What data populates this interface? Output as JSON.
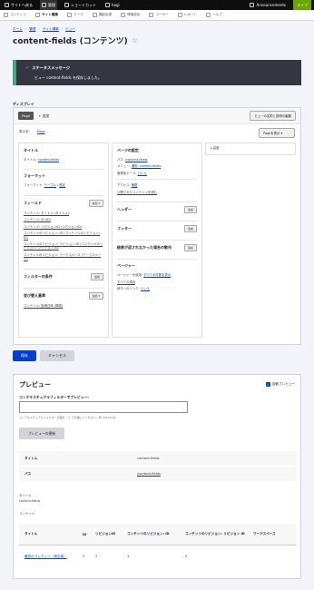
{
  "toolbar": {
    "back_label": "サイトへ戻る",
    "manage_label": "管理",
    "shortcuts_label": "ショートカット",
    "user_label": "hagi",
    "announcements_label": "Announcements",
    "live_label": "ライブ"
  },
  "tray": {
    "items": [
      "コンテンツ",
      "サイト構築",
      "テーマ",
      "機能拡張",
      "環境設定",
      "ユーザー",
      "レポート",
      "ヘルプ"
    ]
  },
  "breadcrumb": [
    "ホーム",
    "管理",
    "サイト構築",
    "ビュー"
  ],
  "page_title": "content-fields (コンテンツ)",
  "status": {
    "title": "ステータスメッセージ",
    "message": "ビュー content-fields を保存しました。"
  },
  "display_label": "ディスプレイ",
  "views_ui": {
    "page_tab": "Page",
    "add_link": "+ 追加",
    "edit_dropdown": "ビューの名前と説明の編集",
    "display_name_label": "表示名:",
    "display_name_value": "Page",
    "page_show_button": "Pageを表示",
    "col1": {
      "title_heading": "タイトル",
      "title_label": "タイトル:",
      "title_value": "content-fields",
      "format_heading": "フォーマット",
      "format_label": "フォーマット:",
      "format_value": "テーブル",
      "format_settings": "設定",
      "fields_heading": "フィールド",
      "fields_button": "追加",
      "fields": [
        "コンテンツ: タイトル (タイトル)",
        "コンテンツ: ID (ID)",
        "コンテンツ: リビジョンID (リビジョンID)",
        "コンテンツのリビジョン: ID (コンテンツのリビジョン: ID)",
        "コンテンツのリビジョン: リビジョン ID (コンテンツのリビジョン: リビジョン ID)",
        "コンテンツのリビジョン: ワークスペース (ワークスペース)"
      ],
      "filter_heading": "フィルターの条件",
      "filter_button": "追加",
      "sort_heading": "並び替え基準",
      "sort_button": "追加",
      "sort_item": "コンテンツ: 投稿日時 (降順)"
    },
    "col2": {
      "page_settings_heading": "ページの設定",
      "path_label": "パス:",
      "path_value": "/content-fields",
      "menu_label": "メニュー:",
      "menu_value": "通常: content-fields",
      "admin_theme_label": "管理用テーマ:",
      "admin_theme_value": "いいえ",
      "access_label": "アクセス:",
      "access_value": "権限",
      "access_detail": "公開されたコンテンツを読む",
      "header_heading": "ヘッダー",
      "header_button": "追加",
      "footer_heading": "フッター",
      "footer_button": "追加",
      "no_results_heading": "結果が返されなかった場合の動作",
      "no_results_button": "追加",
      "pager_heading": "ページャー",
      "pager_label": "ページャーを使用:",
      "pager_value": "すべての件数を表示",
      "pager_all": "すべての項目",
      "more_link_label": "続きへのリンク:",
      "more_link_value": "いいえ"
    },
    "col3": {
      "advanced_heading": "▸ 高度"
    }
  },
  "buttons": {
    "save": "保存",
    "cancel": "キャンセル"
  },
  "preview": {
    "title": "プレビュー",
    "auto_preview": "自動プレビュー",
    "filter_label": "コンテキスチュアルフィルターでプレビュー:",
    "filter_help": "コンテキスチュアルフィルターの値を「/」で分離してください。例: 40/12/10。",
    "update_button": "プレビューの更新",
    "info": [
      {
        "k": "タイトル",
        "v": "content-fields"
      },
      {
        "k": "パス",
        "v": "/content-fields"
      }
    ],
    "small_title_label": "タイトル",
    "small_title_value": "content-fields",
    "content_label": "コンテンツ",
    "table_headers": [
      "タイトル",
      "ID",
      "リビジョンID",
      "コンテンツのリビジョン: ID",
      "コンテンツのリビジョン: リビジョン ID",
      "ワークスペース"
    ],
    "table_rows": [
      [
        "最初のコンテンツ（修正版）",
        "1",
        "2",
        "1",
        "2",
        ""
      ]
    ]
  }
}
